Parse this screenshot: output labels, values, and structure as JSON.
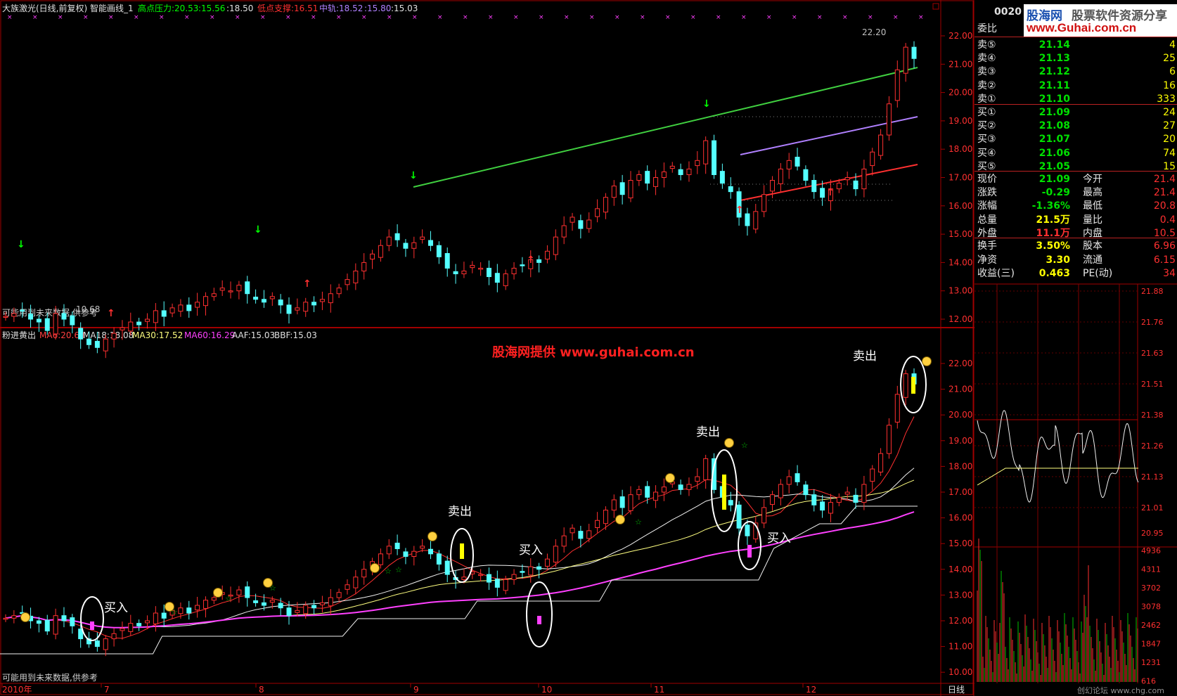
{
  "top_panel": {
    "title": "大族激光(日线,前复权) 智能画线_1",
    "resist_label": "高点压力:20.53",
    "resist_v2": ":15.56",
    "resist_v3": ":18.50",
    "support_label": "低点支撑:16.51",
    "mid_label": "中轨:18.52",
    "mid_v2": ":15.80",
    "mid_v3": ":15.03",
    "y_ticks": [
      "22.00",
      "21.00",
      "20.00",
      "19.00",
      "18.00",
      "17.00",
      "16.00",
      "15.00",
      "14.00",
      "13.00",
      "12.00"
    ],
    "high_mark": "22.20",
    "low_mark": "10.68",
    "footer_note": "可能用到未来数据,供参考"
  },
  "bottom_panel": {
    "title": "粉进黄出",
    "ma6": "MA6:20.68",
    "ma18": "MA18:18.08",
    "ma30": "MA30:17.52",
    "ma60": "MA60:16.29",
    "aaf": "AAF:15.03",
    "bbf": "BBF:15.03",
    "banner": "股海网提供  www.guhai.com.cn",
    "y_ticks": [
      "22.00",
      "21.00",
      "20.00",
      "19.00",
      "18.00",
      "17.00",
      "16.00",
      "15.00",
      "14.00",
      "13.00",
      "12.00",
      "11.00",
      "10.00"
    ],
    "annotations": {
      "buy": "买入",
      "sell": "卖出"
    },
    "footer_note": "可能用到未来数据,供参考"
  },
  "x_axis": {
    "labels": [
      "2010年",
      "7",
      "8",
      "9",
      "10",
      "11",
      "12"
    ],
    "period": "日线"
  },
  "watermark": {
    "site": "股海网",
    "slogan": "股票软件资源分享",
    "url": "www.Guhai.com.cn",
    "code": "0020"
  },
  "quote": {
    "header": "委比",
    "asks": [
      {
        "label": "卖⑤",
        "price": "21.14",
        "vol": "4"
      },
      {
        "label": "卖④",
        "price": "21.13",
        "vol": "25"
      },
      {
        "label": "卖③",
        "price": "21.12",
        "vol": "6"
      },
      {
        "label": "卖②",
        "price": "21.11",
        "vol": "16"
      },
      {
        "label": "卖①",
        "price": "21.10",
        "vol": "333"
      }
    ],
    "bids": [
      {
        "label": "买①",
        "price": "21.09",
        "vol": "24"
      },
      {
        "label": "买②",
        "price": "21.08",
        "vol": "27"
      },
      {
        "label": "买③",
        "price": "21.07",
        "vol": "20"
      },
      {
        "label": "买④",
        "price": "21.06",
        "vol": "74"
      },
      {
        "label": "买⑤",
        "price": "21.05",
        "vol": "15"
      }
    ],
    "stats": [
      {
        "l1": "现价",
        "v1": "21.09",
        "l2": "今开",
        "v2": "21.4"
      },
      {
        "l1": "涨跌",
        "v1": "-0.29",
        "l2": "最高",
        "v2": "21.4"
      },
      {
        "l1": "涨幅",
        "v1": "-1.36%",
        "l2": "最低",
        "v2": "20.8"
      },
      {
        "l1": "总量",
        "v1": "21.5万",
        "l2": "量比",
        "v2": "0.4"
      },
      {
        "l1": "外盘",
        "v1": "11.1万",
        "l2": "内盘",
        "v2": "10.5"
      }
    ],
    "stats2": [
      {
        "l1": "换手",
        "v1": "3.50%",
        "l2": "股本",
        "v2": "6.96"
      },
      {
        "l1": "净资",
        "v1": "3.30",
        "l2": "流通",
        "v2": "6.15"
      },
      {
        "l1": "收益(三)",
        "v1": "0.463",
        "l2": "PE(动)",
        "v2": "34"
      }
    ]
  },
  "intraday": {
    "price_ticks": [
      "21.88",
      "21.76",
      "21.63",
      "21.51",
      "21.38",
      "21.26",
      "21.13",
      "21.01",
      "20.95"
    ],
    "vol_ticks": [
      "4936",
      "4311",
      "3702",
      "3078",
      "2462",
      "1847",
      "1231",
      "616"
    ],
    "footer": "创幻论坛 www.chg.com"
  }
}
